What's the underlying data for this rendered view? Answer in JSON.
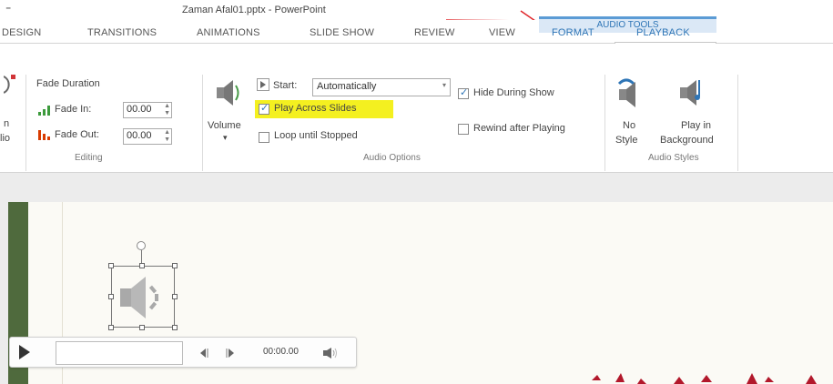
{
  "titlebar": {
    "menu_glyph": "⁼",
    "title": "Zaman Afal01.pptx - PowerPoint"
  },
  "context_header": "AUDIO TOOLS",
  "tabs": {
    "design": "DESIGN",
    "transitions": "TRANSITIONS",
    "animations": "ANIMATIONS",
    "slideshow": "SLIDE SHOW",
    "review": "REVIEW",
    "view": "VIEW",
    "format": "FORMAT",
    "playback": "PLAYBACK"
  },
  "ribbon": {
    "partial_left": {
      "line1": "n",
      "line2": "lio"
    },
    "editing": {
      "fade_duration": "Fade Duration",
      "fade_in_label": "Fade In:",
      "fade_in_value": "00.00",
      "fade_out_label": "Fade Out:",
      "fade_out_value": "00.00",
      "group_label": "Editing"
    },
    "audio_options": {
      "volume": "Volume",
      "start_label": "Start:",
      "start_value": "Automatically",
      "play_across_slides": "Play Across Slides",
      "loop_until_stopped": "Loop until Stopped",
      "hide_during_show": "Hide During Show",
      "rewind_after_playing": "Rewind after Playing",
      "group_label": "Audio Options"
    },
    "audio_styles": {
      "no_style_1": "No",
      "no_style_2": "Style",
      "play_bg_1": "Play in",
      "play_bg_2": "Background",
      "group_label": "Audio Styles"
    }
  },
  "player": {
    "time": "00:00.00"
  },
  "colors": {
    "accent": "#2e75b6",
    "highlight": "#f4f020",
    "band": "#4f6a3d",
    "arrow": "#e0262a"
  }
}
